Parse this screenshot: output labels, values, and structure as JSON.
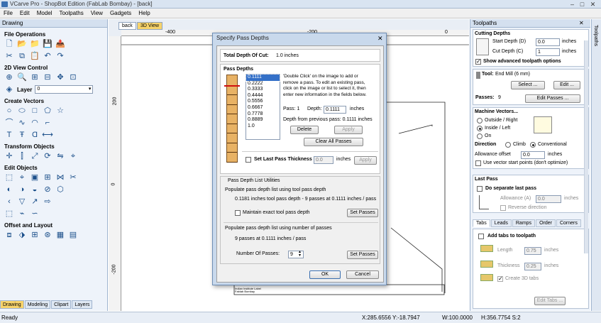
{
  "window": {
    "title": "VCarve Pro - ShopBot Edition (FabLab Bombay) - [back]"
  },
  "menu": [
    "File",
    "Edit",
    "Model",
    "Toolpaths",
    "View",
    "Gadgets",
    "Help"
  ],
  "left_panel": {
    "title": "Drawing",
    "sections": {
      "file_ops": "File Operations",
      "view_control": "2D View Control",
      "layer_label": "Layer",
      "layer_value": "0",
      "create_vectors": "Create Vectors",
      "transform": "Transform Objects",
      "edit": "Edit Objects",
      "offset": "Offset and Layout"
    },
    "bottom_tabs": [
      "Drawing",
      "Modeling",
      "Clipart",
      "Layers"
    ]
  },
  "doc": {
    "tabs": [
      "back",
      "3D View"
    ],
    "ruler_h": [
      "-400",
      "-200",
      "0"
    ],
    "ruler_v": [
      "200",
      "0",
      "-200"
    ],
    "drawing_label": "Drawing...",
    "titleblock_lines": [
      "Indian Institute Label",
      "Fablab Bombay"
    ]
  },
  "dialog": {
    "title": "Specify Pass Depths",
    "total_depth_label": "Total Depth Of Cut:",
    "total_depth_value": "1.0 inches",
    "pass_depths_title": "Pass Depths",
    "passes": [
      "0.1111",
      "0.2222",
      "0.3333",
      "0.4444",
      "0.5556",
      "0.6667",
      "0.7778",
      "0.8889",
      "1.0"
    ],
    "instructions": [
      "'Double Click' on the image to add or",
      "remove a pass. To edit an existing pass,",
      "click on the image or list to select it, then",
      "enter new information in the fields below."
    ],
    "pass_label": "Pass: 1",
    "depth_label": "Depth:",
    "depth_value": "0.1111",
    "depth_unit": "inches",
    "depth_prev": "Depth from previous pass:  0.1111 inches",
    "delete_btn": "Delete",
    "apply_btn": "Apply",
    "clear_btn": "Clear All Passes",
    "set_last_label": "Set Last Pass Thickness",
    "set_last_value": "0.0",
    "set_last_unit": "inches",
    "set_last_apply": "Apply",
    "utilities_title": "Pass Depth List Utilities",
    "util1_title": "Populate pass depth list using tool pass depth",
    "util1_desc": "0.1181 inches tool pass depth - 9 passes at 0.1111 inches / pass",
    "maintain_label": "Maintain exact tool pass depth",
    "set_passes_btn": "Set Passes",
    "util2_title": "Populate pass depth list using number of passes",
    "util2_desc": "9 passes at 0.1111 inches / pass",
    "num_passes_label": "Number Of Passes:",
    "num_passes_value": "9",
    "ok_btn": "OK",
    "cancel_btn": "Cancel"
  },
  "right_panel": {
    "title": "Toolpaths",
    "cutting_depths": {
      "title": "Cutting Depths",
      "start_label": "Start Depth (D)",
      "start_value": "0.0",
      "cut_label": "Cut Depth (C)",
      "cut_value": "1",
      "unit": "inches",
      "show_adv": "Show advanced toolpath options"
    },
    "tool": {
      "label": "Tool:",
      "value": "End Mill (6 mm)",
      "select_btn": "Select ...",
      "edit_btn": "Edit ...",
      "passes_label": "Passes:",
      "passes_value": "9",
      "edit_passes_btn": "Edit Passes ..."
    },
    "machine_vectors": {
      "title": "Machine Vectors...",
      "outside": "Outside / Right",
      "inside": "Inside / Left",
      "on": "On",
      "direction_label": "Direction",
      "climb": "Climb",
      "conventional": "Conventional",
      "allowance_label": "Allowance offset",
      "allowance_value": "0.0",
      "allowance_unit": "inches",
      "vector_start": "Use vector start points (don't optimize)"
    },
    "last_pass": {
      "title": "Last Pass",
      "separate": "Do separate last pass",
      "allowance_label": "Allowance (A)",
      "allowance_value": "0.0",
      "unit": "inches",
      "reverse": "Reverse direction"
    },
    "tabs": [
      "Tabs",
      "Leads",
      "Ramps",
      "Order",
      "Corners"
    ],
    "tabs_panel": {
      "add_tabs": "Add tabs to toolpath",
      "length_label": "Length",
      "length_value": "0.75",
      "thickness_label": "Thickness",
      "thickness_value": "0.25",
      "unit": "inches",
      "create3d": "Create 3D tabs",
      "edit_tabs_btn": "Edit Tabs ..."
    }
  },
  "side_strip": "Toolpaths",
  "status": {
    "ready": "Ready",
    "coords": "X:285.6556 Y:-18.7947",
    "width": "W:100.0000",
    "height": "H:356.7754  S:2"
  }
}
